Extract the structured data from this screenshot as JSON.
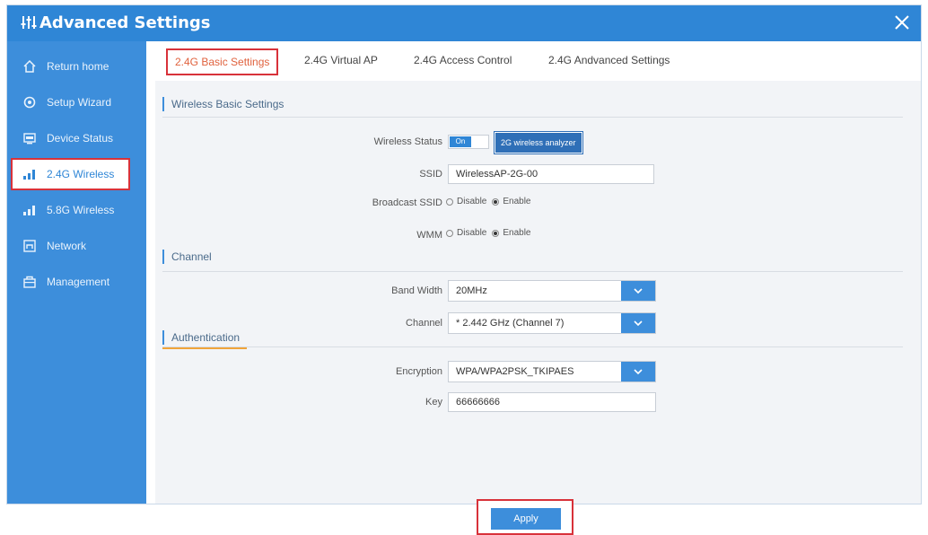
{
  "window": {
    "title": "Advanced Settings"
  },
  "sidebar": {
    "items": [
      {
        "label": "Return home",
        "icon": "home-icon"
      },
      {
        "label": "Setup Wizard",
        "icon": "wizard-icon"
      },
      {
        "label": "Device Status",
        "icon": "monitor-icon"
      },
      {
        "label": "2.4G Wireless",
        "icon": "signal-icon",
        "active": true
      },
      {
        "label": "5.8G Wireless",
        "icon": "signal-icon"
      },
      {
        "label": "Network",
        "icon": "network-icon"
      },
      {
        "label": "Management",
        "icon": "toolbox-icon"
      }
    ]
  },
  "tabs": [
    {
      "label": "2.4G Basic Settings",
      "active": true
    },
    {
      "label": "2.4G Virtual AP"
    },
    {
      "label": "2.4G Access Control"
    },
    {
      "label": "2.4G Andvanced Settings"
    }
  ],
  "sections": {
    "basic": "Wireless Basic Settings",
    "channel": "Channel",
    "auth": "Authentication"
  },
  "form": {
    "wireless_status": {
      "label": "Wireless Status",
      "toggle": "On",
      "analyzer": "2G wireless analyzer"
    },
    "ssid": {
      "label": "SSID",
      "value": "WirelessAP-2G-00"
    },
    "broadcast_ssid": {
      "label": "Broadcast SSID",
      "options": [
        "Disable",
        "Enable"
      ],
      "selected": "Enable"
    },
    "wmm": {
      "label": "WMM",
      "options": [
        "Disable",
        "Enable"
      ],
      "selected": "Enable"
    },
    "band_width": {
      "label": "Band Width",
      "value": "20MHz"
    },
    "channel": {
      "label": "Channel",
      "value": "* 2.442 GHz (Channel 7)"
    },
    "encryption": {
      "label": "Encryption",
      "value": "WPA/WPA2PSK_TKIPAES"
    },
    "key": {
      "label": "Key",
      "value": "66666666"
    }
  },
  "actions": {
    "apply": "Apply"
  },
  "colors": {
    "primary": "#2f86d6",
    "sidebar": "#3d8edb",
    "highlight": "#d8323a",
    "accent_underline": "#f0a43a"
  }
}
